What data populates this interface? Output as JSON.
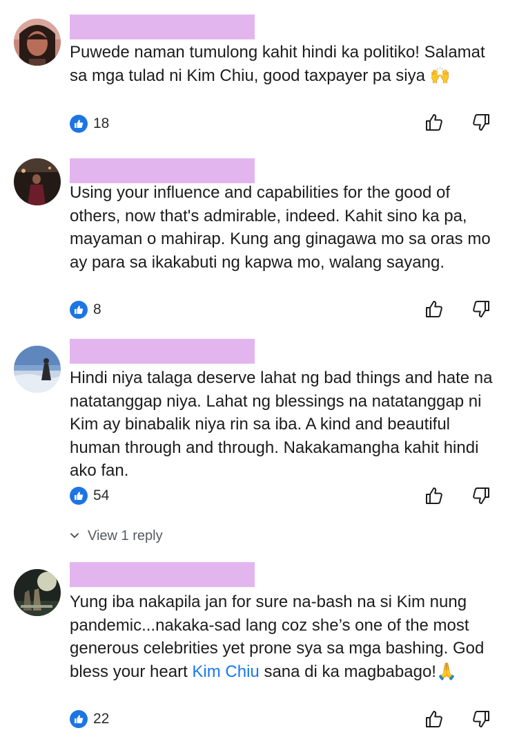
{
  "theme": {
    "redaction_color": "#e3b5ef",
    "like_badge_color": "#1d75e4",
    "mention_color": "#1877f2"
  },
  "comments": [
    {
      "text_parts": [
        {
          "text": "Puwede naman tumulong kahit hindi ka politiko! Salamat sa mga tulad ni Kim Chiu, good taxpayer pa siya 🙌"
        }
      ],
      "likes": "18"
    },
    {
      "text_parts": [
        {
          "text": "Using your influence and capabilities for the good of others, now that's admirable, indeed. Kahit sino ka pa, mayaman o mahirap. Kung ang ginagawa mo sa oras mo ay para sa ikakabuti ng kapwa mo, walang sayang."
        }
      ],
      "likes": "8"
    },
    {
      "text_parts": [
        {
          "text": "Hindi niya talaga deserve lahat ng bad things and hate na natatanggap niya. Lahat ng blessings na natatanggap ni Kim ay binabalik niya rin sa iba. A kind and beautiful human through and through. Nakakamangha kahit hindi ako fan."
        }
      ],
      "likes": "54",
      "view_replies": "View 1 reply"
    },
    {
      "text_parts": [
        {
          "text": "Yung iba nakapila jan for sure na-bash na si Kim nung pandemic...nakaka-sad lang coz she’s one of the most generous celebrities yet prone sya sa mga bashing. God bless your heart "
        },
        {
          "text": "Kim Chiu",
          "mention": true
        },
        {
          "text": " sana di ka magbabago!🙏"
        }
      ],
      "likes": "22"
    }
  ],
  "icons": {
    "like_badge": "thumbs-up-badge-icon",
    "upvote": "thumbs-up-outline-icon",
    "downvote": "thumbs-down-outline-icon",
    "expand": "chevron-down-icon"
  }
}
